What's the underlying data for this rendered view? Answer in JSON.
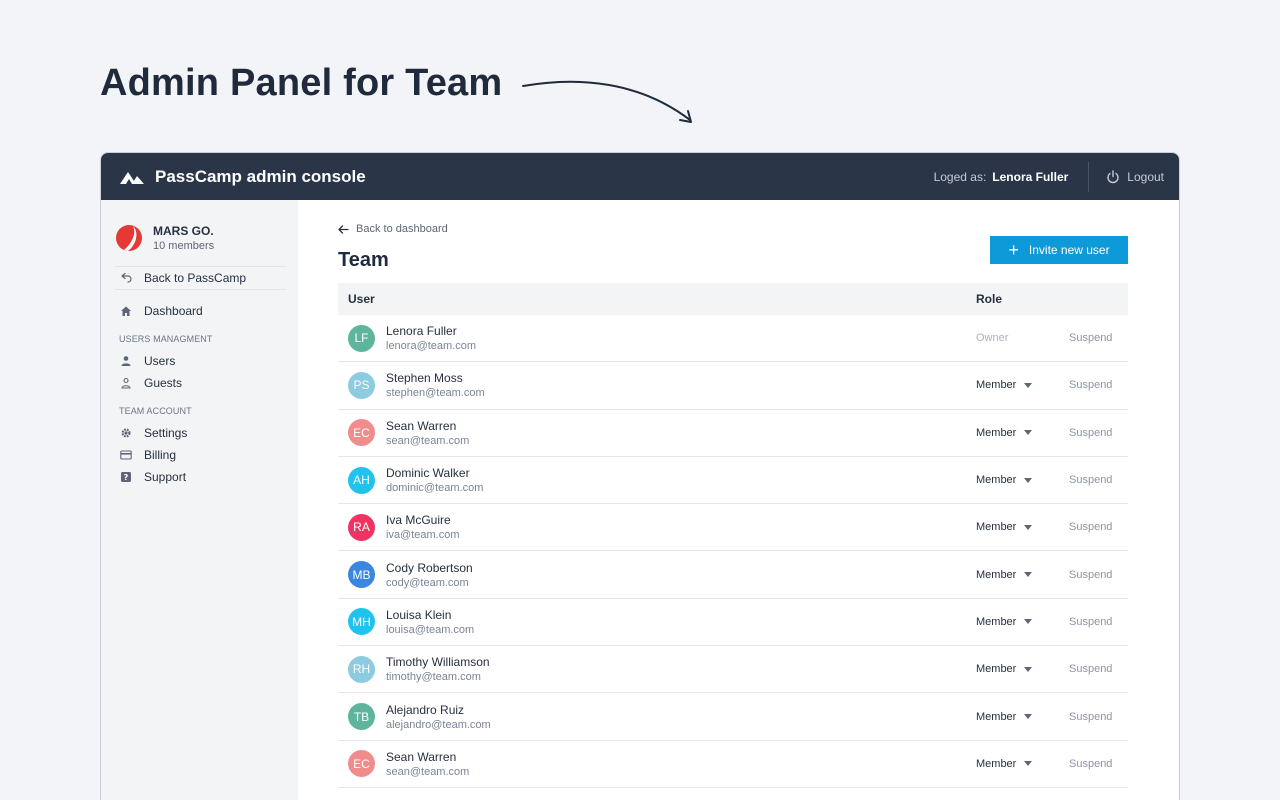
{
  "headline": "Admin Panel for Team",
  "topbar": {
    "app_title": "PassCamp admin console",
    "loged_label": "Loged as:",
    "user_name": "Lenora Fuller",
    "logout_label": "Logout"
  },
  "sidebar": {
    "team_name": "MARS GO.",
    "team_members": "10 members",
    "back_label": "Back to PassCamp",
    "dashboard_label": "Dashboard",
    "section_users": "USERS MANAGMENT",
    "users_label": "Users",
    "guests_label": "Guests",
    "section_team": "TEAM ACCOUNT",
    "settings_label": "Settings",
    "billing_label": "Billing",
    "support_label": "Support"
  },
  "main": {
    "back_label": "Back to dashboard",
    "title": "Team",
    "invite_label": "Invite new user",
    "col_user": "User",
    "col_role": "Role"
  },
  "colors": {
    "accent": "#0e9ad8",
    "topbar": "#2a3548"
  },
  "users": [
    {
      "initials": "LF",
      "name": "Lenora Fuller",
      "email": "lenora@team.com",
      "role": "Owner",
      "action": "Suspend",
      "color": "#5fb49c"
    },
    {
      "initials": "PS",
      "name": "Stephen Moss",
      "email": "stephen@team.com",
      "role": "Member",
      "action": "Suspend",
      "color": "#8ccbe0"
    },
    {
      "initials": "EC",
      "name": "Sean Warren",
      "email": "sean@team.com",
      "role": "Member",
      "action": "Suspend",
      "color": "#f28b8c"
    },
    {
      "initials": "AH",
      "name": "Dominic Walker",
      "email": "dominic@team.com",
      "role": "Member",
      "action": "Suspend",
      "color": "#1ec4ee"
    },
    {
      "initials": "RA",
      "name": "Iva McGuire",
      "email": "iva@team.com",
      "role": "Member",
      "action": "Suspend",
      "color": "#ef3463"
    },
    {
      "initials": "MB",
      "name": "Cody Robertson",
      "email": "cody@team.com",
      "role": "Member",
      "action": "Suspend",
      "color": "#3b86e0"
    },
    {
      "initials": "MH",
      "name": "Louisa Klein",
      "email": "louisa@team.com",
      "role": "Member",
      "action": "Suspend",
      "color": "#1ec4ee"
    },
    {
      "initials": "RH",
      "name": "Timothy Williamson",
      "email": "timothy@team.com",
      "role": "Member",
      "action": "Suspend",
      "color": "#8ccbe0"
    },
    {
      "initials": "TB",
      "name": "Alejandro Ruiz",
      "email": "alejandro@team.com",
      "role": "Member",
      "action": "Suspend",
      "color": "#5fb49c"
    },
    {
      "initials": "EC",
      "name": "Sean Warren",
      "email": "sean@team.com",
      "role": "Member",
      "action": "Suspend",
      "color": "#f28b8c"
    }
  ]
}
